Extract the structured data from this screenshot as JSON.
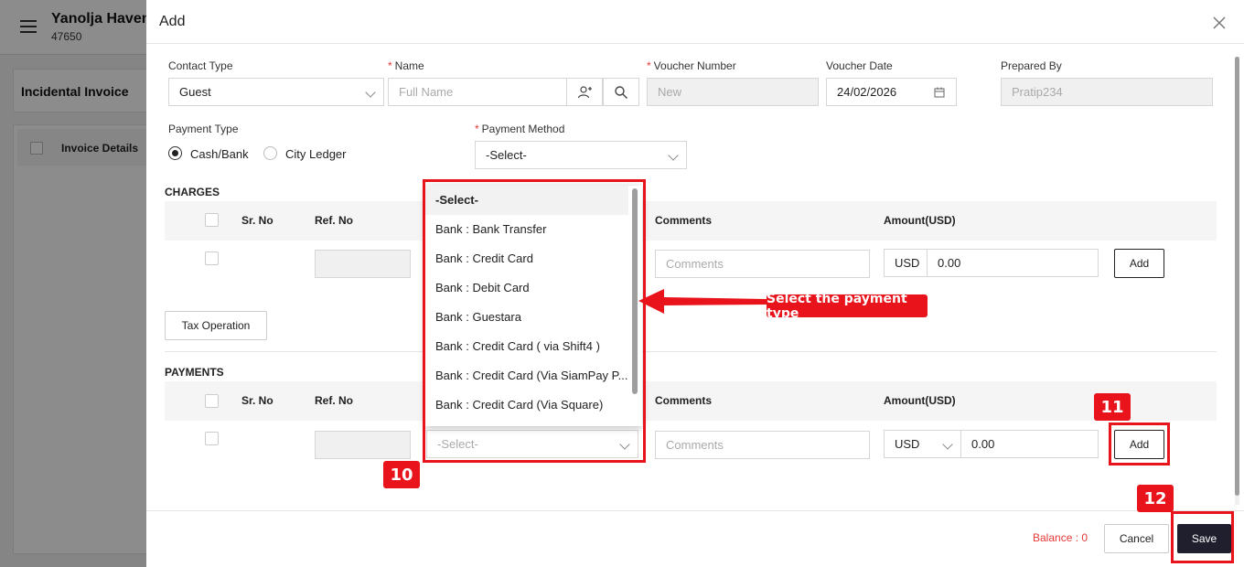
{
  "background": {
    "hotel_name": "Yanolja Haven",
    "hotel_code": "47650",
    "page_title": "Incidental Invoice",
    "invoice_details": "Invoice Details"
  },
  "modal": {
    "title": "Add",
    "contact_type": {
      "label": "Contact Type",
      "value": "Guest"
    },
    "name": {
      "label": "Name",
      "placeholder": "Full Name"
    },
    "voucher_number": {
      "label": "Voucher Number",
      "value": "New"
    },
    "voucher_date": {
      "label": "Voucher Date",
      "value": "24/02/2026"
    },
    "prepared_by": {
      "label": "Prepared By",
      "value": "Pratip234"
    },
    "payment_type": {
      "label": "Payment Type",
      "options": [
        "Cash/Bank",
        "City Ledger"
      ],
      "selected": "Cash/Bank"
    },
    "payment_method": {
      "label": "Payment Method",
      "value": "-Select-"
    },
    "charges": {
      "title": "CHARGES",
      "columns": [
        "Sr. No",
        "Ref. No",
        "Comments",
        "Amount(USD)"
      ],
      "row": {
        "comments_placeholder": "Comments",
        "currency": "USD",
        "amount": "0.00",
        "add_label": "Add"
      }
    },
    "tax_operation_label": "Tax Operation",
    "payments": {
      "title": "PAYMENTS",
      "columns": [
        "Sr. No",
        "Ref. No",
        "Comments",
        "Amount(USD)"
      ],
      "row": {
        "method_placeholder": "-Select-",
        "comments_placeholder": "Comments",
        "currency": "USD",
        "amount": "0.00",
        "add_label": "Add"
      }
    },
    "footer": {
      "balance": "Balance : 0",
      "cancel_label": "Cancel",
      "save_label": "Save"
    }
  },
  "dropdown_options": [
    "-Select-",
    "Bank : Bank Transfer",
    "Bank : Credit Card",
    "Bank : Debit Card",
    "Bank : Guestara",
    "Bank : Credit Card ( via Shift4 )",
    "Bank : Credit Card (Via SiamPay P...",
    "Bank : Credit Card (Via Square)"
  ],
  "annotations": {
    "callout": "Select the payment type",
    "badge_10": "10",
    "badge_11": "11",
    "badge_12": "12",
    "color": "#e8131b"
  }
}
